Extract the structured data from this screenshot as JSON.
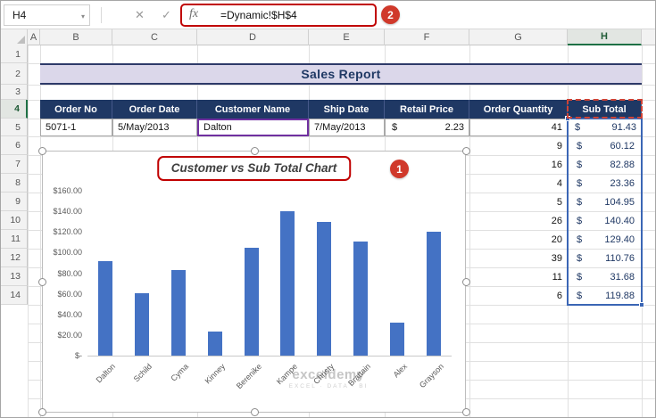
{
  "formula_bar": {
    "name_box": "H4",
    "dropdown_icon": "▾",
    "cancel_icon": "✕",
    "enter_icon": "✓",
    "fx_label": "fx",
    "formula": "=Dynamic!$H$4"
  },
  "annotations": {
    "badge1": "1",
    "badge2": "2",
    "accent_color": "#C00000"
  },
  "grid": {
    "column_headers": [
      "A",
      "B",
      "C",
      "D",
      "E",
      "F",
      "G",
      "H"
    ],
    "row_headers": [
      "1",
      "2",
      "3",
      "4",
      "5",
      "6",
      "7",
      "8",
      "9",
      "10",
      "11",
      "12",
      "13",
      "14"
    ]
  },
  "report": {
    "title": "Sales Report",
    "currency": "$",
    "table_headers": [
      "Order No",
      "Order Date",
      "Customer Name",
      "Ship Date",
      "Retail Price",
      "Order Quantity",
      "Sub Total"
    ],
    "first_row": {
      "order_no": "5071-1",
      "order_date": "5/May/2013",
      "customer": "Dalton",
      "ship_date": "7/May/2013",
      "retail_price": "2.23"
    },
    "rows": [
      {
        "qty": "41",
        "sub": "91.43"
      },
      {
        "qty": "9",
        "sub": "60.12"
      },
      {
        "qty": "16",
        "sub": "82.88"
      },
      {
        "qty": "4",
        "sub": "23.36"
      },
      {
        "qty": "5",
        "sub": "104.95"
      },
      {
        "qty": "26",
        "sub": "140.40"
      },
      {
        "qty": "20",
        "sub": "129.40"
      },
      {
        "qty": "39",
        "sub": "110.76"
      },
      {
        "qty": "11",
        "sub": "31.68"
      },
      {
        "qty": "6",
        "sub": "119.88"
      }
    ]
  },
  "chart_data": {
    "type": "bar",
    "title": "Customer vs Sub Total Chart",
    "series_name": "Sub Total",
    "categories": [
      "Dalton",
      "Schild",
      "Cyma",
      "Kinney",
      "Berenike",
      "Kampe",
      "Christy",
      "Brattain",
      "Alex",
      "Grayson"
    ],
    "values": [
      91.43,
      60.12,
      82.88,
      23.36,
      104.95,
      140.4,
      129.4,
      110.76,
      31.68,
      119.88
    ],
    "xlabel": "",
    "ylabel": "",
    "ylim": [
      0,
      160
    ],
    "y_ticks": [
      "$160.00",
      "$140.00",
      "$120.00",
      "$100.00",
      "$80.00",
      "$60.00",
      "$40.00",
      "$20.00",
      "$-"
    ],
    "grid": false,
    "legend": false,
    "bar_color": "#4472C4"
  },
  "watermark": {
    "brand": "exceldemy",
    "tagline": "EXCEL · DATA · BI"
  }
}
